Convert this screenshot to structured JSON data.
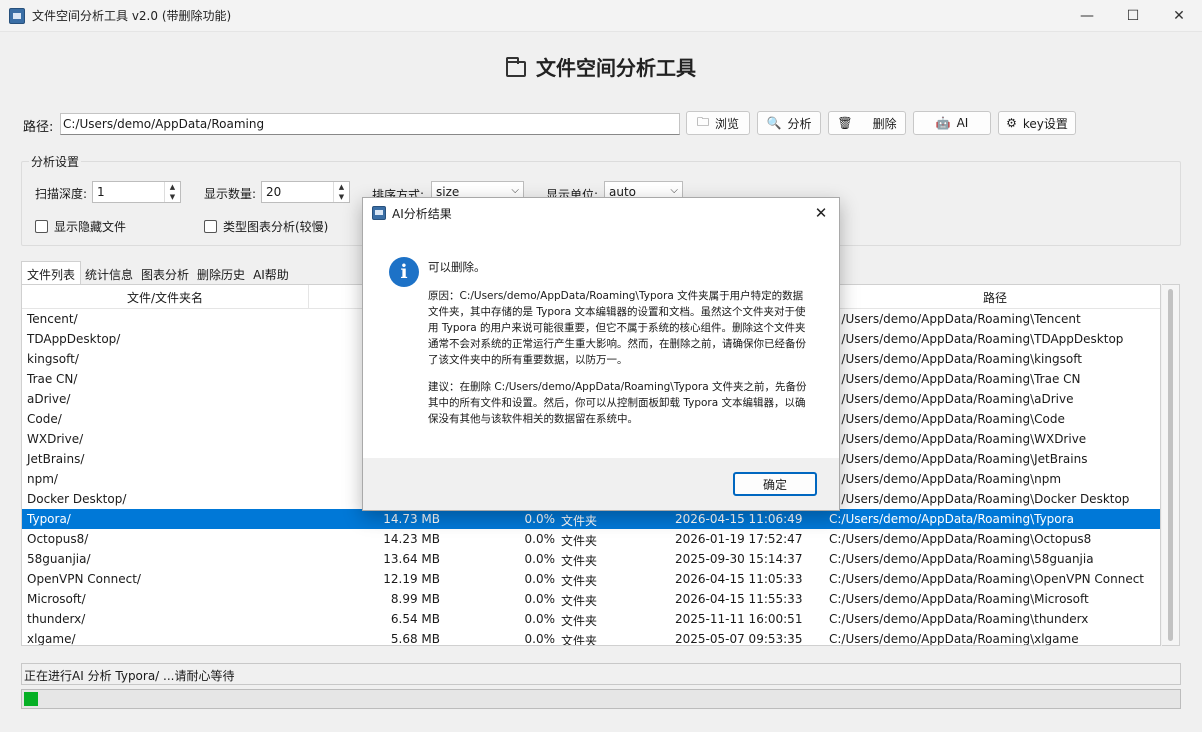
{
  "window": {
    "title": "文件空间分析工具 v2.0 (带删除功能)",
    "controls": [
      "—",
      "☐",
      "✕"
    ]
  },
  "header": {
    "title": "文件空间分析工具"
  },
  "path": {
    "label": "路径:",
    "value": "C:/Users/demo/AppData/Roaming"
  },
  "toolbar": {
    "browse": {
      "icon": "🗀",
      "label": "浏览"
    },
    "analyze": {
      "icon": "🔍",
      "label": "分析"
    },
    "delete": {
      "icon": "🗑",
      "label": "删除"
    },
    "ai": {
      "icon": "🤖",
      "label": "AI"
    },
    "key": {
      "icon": "⚙",
      "label": "key设置"
    }
  },
  "settings": {
    "title": "分析设置",
    "depth_label": "扫描深度:",
    "depth_value": "1",
    "count_label": "显示数量:",
    "count_value": "20",
    "sort_label": "排序方式:",
    "sort_value": "size",
    "unit_label": "显示单位:",
    "unit_value": "auto",
    "show_hidden": "显示隐藏文件",
    "type_chart": "类型图表分析(较慢)"
  },
  "tabs": [
    "文件列表",
    "统计信息",
    "图表分析",
    "删除历史",
    "AI帮助"
  ],
  "table": {
    "headers": {
      "name": "文件/文件夹名",
      "path": "路径"
    },
    "rows": [
      {
        "name": "Tencent/",
        "size": "",
        "pct": "",
        "type": "",
        "date": "",
        "path": "C:/Users/demo/AppData/Roaming\\Tencent"
      },
      {
        "name": "TDAppDesktop/",
        "size": "",
        "pct": "",
        "type": "",
        "date": "",
        "path": "C:/Users/demo/AppData/Roaming\\TDAppDesktop"
      },
      {
        "name": "kingsoft/",
        "size": "",
        "pct": "",
        "type": "",
        "date": "",
        "path": "C:/Users/demo/AppData/Roaming\\kingsoft"
      },
      {
        "name": "Trae CN/",
        "size": "",
        "pct": "",
        "type": "",
        "date": "",
        "path": "C:/Users/demo/AppData/Roaming\\Trae CN"
      },
      {
        "name": "aDrive/",
        "size": "",
        "pct": "",
        "type": "",
        "date": "",
        "path": "C:/Users/demo/AppData/Roaming\\aDrive"
      },
      {
        "name": "Code/",
        "size": "",
        "pct": "",
        "type": "",
        "date": "",
        "path": "C:/Users/demo/AppData/Roaming\\Code"
      },
      {
        "name": "WXDrive/",
        "size": "",
        "pct": "",
        "type": "",
        "date": "",
        "path": "C:/Users/demo/AppData/Roaming\\WXDrive"
      },
      {
        "name": "JetBrains/",
        "size": "",
        "pct": "",
        "type": "",
        "date": "",
        "path": "C:/Users/demo/AppData/Roaming\\JetBrains"
      },
      {
        "name": "npm/",
        "size": "",
        "pct": "",
        "type": "",
        "date": "",
        "path": "C:/Users/demo/AppData/Roaming\\npm"
      },
      {
        "name": "Docker Desktop/",
        "size": "",
        "pct": "",
        "type": "",
        "date": "",
        "path": "C:/Users/demo/AppData/Roaming\\Docker Desktop"
      },
      {
        "name": "Typora/",
        "size": "14.73 MB",
        "pct": "0.0%",
        "type": "文件夹",
        "date": "2026-04-15 11:06:49",
        "path": "C:/Users/demo/AppData/Roaming\\Typora",
        "selected": true
      },
      {
        "name": "Octopus8/",
        "size": "14.23 MB",
        "pct": "0.0%",
        "type": "文件夹",
        "date": "2026-01-19 17:52:47",
        "path": "C:/Users/demo/AppData/Roaming\\Octopus8"
      },
      {
        "name": "58guanjia/",
        "size": "13.64 MB",
        "pct": "0.0%",
        "type": "文件夹",
        "date": "2025-09-30 15:14:37",
        "path": "C:/Users/demo/AppData/Roaming\\58guanjia"
      },
      {
        "name": "OpenVPN Connect/",
        "size": "12.19 MB",
        "pct": "0.0%",
        "type": "文件夹",
        "date": "2026-04-15 11:05:33",
        "path": "C:/Users/demo/AppData/Roaming\\OpenVPN Connect"
      },
      {
        "name": "Microsoft/",
        "size": "8.99 MB",
        "pct": "0.0%",
        "type": "文件夹",
        "date": "2026-04-15 11:55:33",
        "path": "C:/Users/demo/AppData/Roaming\\Microsoft"
      },
      {
        "name": "thunderx/",
        "size": "6.54 MB",
        "pct": "0.0%",
        "type": "文件夹",
        "date": "2025-11-11 16:00:51",
        "path": "C:/Users/demo/AppData/Roaming\\thunderx"
      },
      {
        "name": "xlgame/",
        "size": "5.68 MB",
        "pct": "0.0%",
        "type": "文件夹",
        "date": "2025-05-07 09:53:35",
        "path": "C:/Users/demo/AppData/Roaming\\xlgame"
      }
    ]
  },
  "status": {
    "text": "正在进行AI 分析 Typora/ ...请耐心等待",
    "progress": 0.012
  },
  "dialog": {
    "title": "AI分析结果",
    "close": "✕",
    "info_icon": "i",
    "headline": "可以删除。",
    "reason": "原因：C:/Users/demo/AppData/Roaming\\Typora 文件夹属于用户特定的数据文件夹，其中存储的是 Typora 文本编辑器的设置和文档。虽然这个文件夹对于使用 Typora 的用户来说可能很重要，但它不属于系统的核心组件。删除这个文件夹通常不会对系统的正常运行产生重大影响。然而，在删除之前，请确保你已经备份了该文件夹中的所有重要数据，以防万一。",
    "suggestion": "建议：在删除 C:/Users/demo/AppData/Roaming\\Typora 文件夹之前，先备份其中的所有文件和设置。然后，你可以从控制面板卸载 Typora 文本编辑器，以确保没有其他与该软件相关的数据留在系统中。",
    "ok": "确定"
  },
  "colors": {
    "selection": "#0078d7",
    "progress": "#06b025",
    "info": "#1d72c7"
  }
}
